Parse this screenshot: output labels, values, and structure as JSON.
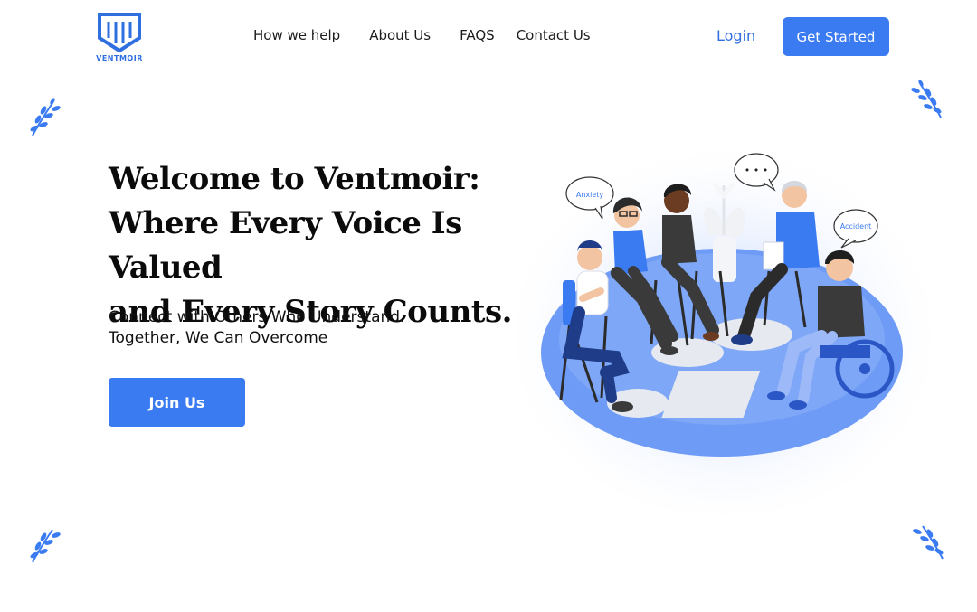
{
  "brand": {
    "name": "VENTMOIR",
    "color": "#2f6fe0"
  },
  "nav": {
    "items": [
      "How we help",
      "About Us",
      "FAQS",
      "Contact Us"
    ],
    "login": "Login",
    "cta": "Get Started"
  },
  "hero": {
    "title_line1": "Welcome to Ventmoir:",
    "title_line2": "Where Every Voice Is Valued",
    "title_line3": "and Every Story Counts.",
    "sub_line1": "Connect with Others Who Understand.",
    "sub_line2": "Together, We Can Overcome",
    "button": "Join Us"
  },
  "illustration": {
    "bubble_left": "Anxiety",
    "bubble_middle": "• • •",
    "bubble_right": "Accident"
  },
  "colors": {
    "accent": "#3b7bf2",
    "platform": "#6e9bf5",
    "text": "#111111"
  }
}
